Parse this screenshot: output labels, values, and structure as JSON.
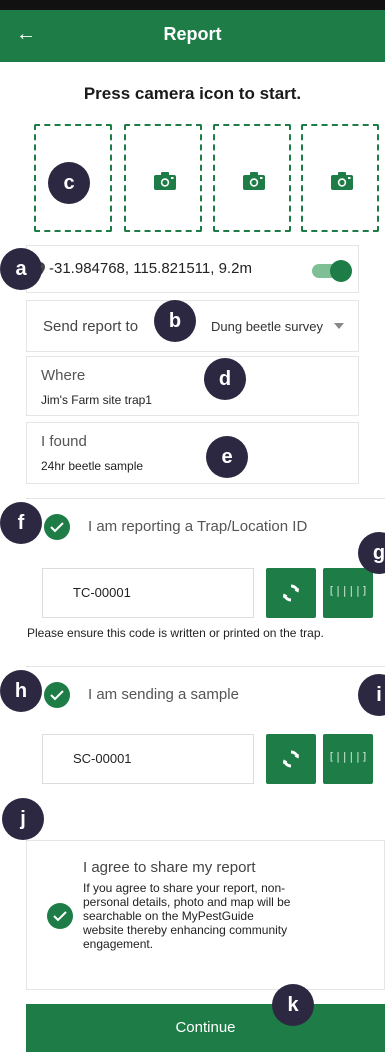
{
  "header": {
    "back_icon": "arrow-left-icon",
    "title": "Report"
  },
  "instruction": "Press camera icon to start.",
  "photos": [
    {
      "icon": "none"
    },
    {
      "icon": "camera-icon"
    },
    {
      "icon": "camera-icon"
    },
    {
      "icon": "camera-icon"
    }
  ],
  "location": {
    "icon": "map-pin-icon",
    "coords": "-31.984768, 115.821511, 9.2m",
    "enabled": true
  },
  "send_to": {
    "label": "Send report to",
    "value": "Dung beetle survey"
  },
  "where": {
    "label": "Where",
    "value": "Jim's Farm site trap1"
  },
  "found": {
    "label": "I found",
    "value": "24hr beetle sample"
  },
  "trap": {
    "checked": true,
    "label": "I am reporting a Trap/Location ID",
    "code": "TC-00001",
    "note": "Please ensure this code is written or printed on the trap."
  },
  "sample": {
    "checked": true,
    "label": "I am sending a sample",
    "code": "SC-00001"
  },
  "barcode_glyph": "[||||]",
  "share": {
    "checked": true,
    "title": "I agree to share my report",
    "description": "If you agree to share your report, non-personal details, photo and map will be searchable on the MyPestGuide website thereby enhancing community engagement."
  },
  "continue_label": "Continue",
  "markers": [
    "a",
    "b",
    "c",
    "d",
    "e",
    "f",
    "g",
    "h",
    "i",
    "j",
    "k"
  ],
  "colors": {
    "primary": "#1e7d46",
    "toggle_track": "#7fbf96",
    "marker": "#2c2842"
  }
}
